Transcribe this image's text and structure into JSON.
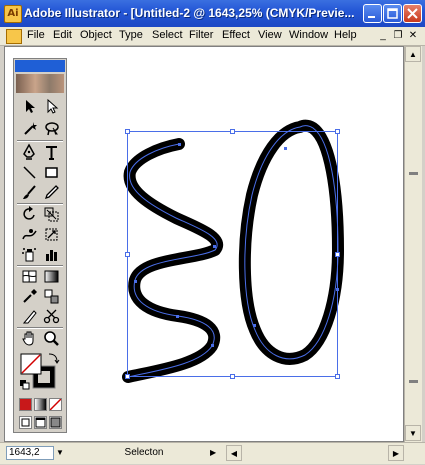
{
  "window": {
    "title": "Adobe Illustrator - [Untitled-2 @ 1643,25% (CMYK/Previe..."
  },
  "menubar": {
    "items": [
      "File",
      "Edit",
      "Object",
      "Type",
      "Select",
      "Filter",
      "Effect",
      "View",
      "Window",
      "Help"
    ]
  },
  "tools": [
    "selection-tool",
    "direct-selection-tool",
    "magic-wand-tool",
    "lasso-tool",
    "pen-tool",
    "type-tool",
    "line-segment-tool",
    "rectangle-tool",
    "paintbrush-tool",
    "pencil-tool",
    "rotate-tool",
    "scale-tool",
    "warp-tool",
    "free-transform-tool",
    "symbol-sprayer-tool",
    "column-graph-tool",
    "mesh-tool",
    "gradient-tool",
    "eyedropper-tool",
    "blend-tool",
    "slice-tool",
    "scissors-tool",
    "hand-tool",
    "zoom-tool"
  ],
  "colors": {
    "fill": "#ffffff",
    "stroke": "#000000",
    "selection": "#4a6ee8",
    "titlebar": "#2457d6"
  },
  "statusbar": {
    "zoom": "1643,2",
    "status": "Selecton"
  }
}
